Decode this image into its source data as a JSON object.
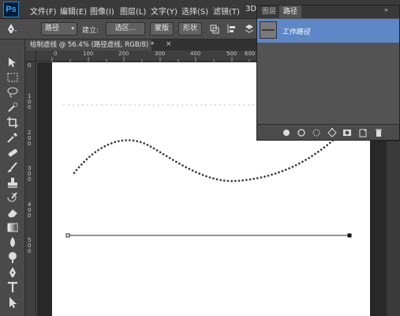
{
  "app": {
    "logo": "Ps"
  },
  "menu": [
    "文件(F)",
    "编辑(E)",
    "图像(I)",
    "图层(L)",
    "文字(Y)",
    "选择(S)",
    "滤镜(T)",
    "3D"
  ],
  "options": {
    "mode_value": "路径",
    "make_label": "建立:",
    "selection_button": "选区...",
    "mask_button": "蒙版",
    "shape_button": "形状"
  },
  "document": {
    "tab_title": "绘制虚线 @ 56.4% (路径虚线, RGB/8) *",
    "close": "×"
  },
  "ruler": {
    "h_ticks": [
      "0",
      "100",
      "200",
      "300",
      "400",
      "500",
      "600"
    ],
    "v_ticks": [
      "0",
      "1\n0\n0",
      "2\n0\n0",
      "3\n0\n0",
      "4\n0\n0",
      "5\n0\n0"
    ]
  },
  "tools": [
    "move-icon",
    "marquee-icon",
    "lasso-icon",
    "quick-select-icon",
    "crop-icon",
    "eyedropper-icon",
    "healing-brush-icon",
    "brush-icon",
    "clone-stamp-icon",
    "history-brush-icon",
    "eraser-icon",
    "gradient-icon",
    "blur-icon",
    "dodge-icon",
    "pen-icon",
    "type-icon",
    "path-select-icon",
    "rectangle-icon"
  ],
  "panel": {
    "tabs": [
      "图层",
      "路径"
    ],
    "active_tab": "路径",
    "paths": [
      {
        "name": "工作路径"
      }
    ],
    "footer_icons": [
      "fill-path-icon",
      "stroke-path-icon",
      "load-selection-icon",
      "make-path-icon",
      "add-mask-icon",
      "new-path-icon",
      "delete-path-icon"
    ]
  },
  "colors": {
    "accent_selected": "#5e87c7",
    "canvas": "#ffffff",
    "workspace": "#282828"
  }
}
